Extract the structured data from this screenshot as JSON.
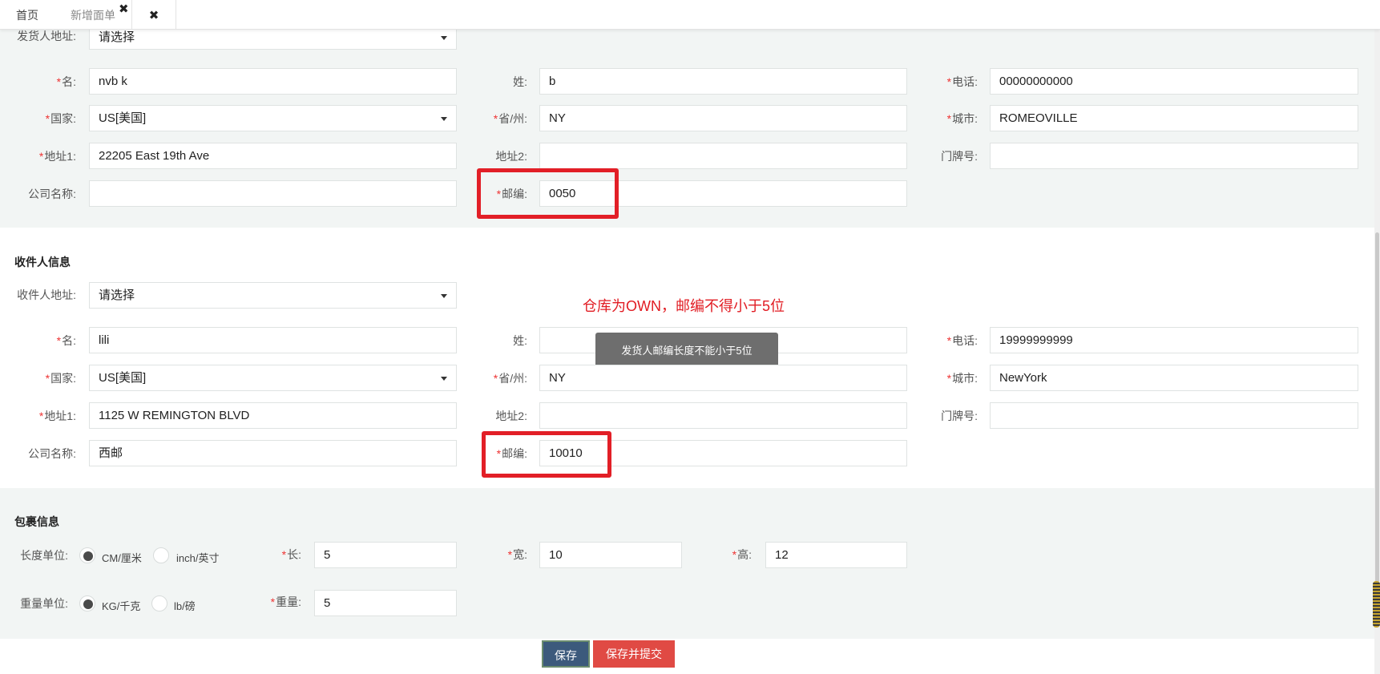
{
  "tabs": [
    {
      "label": "首页"
    },
    {
      "label": "新增面单"
    }
  ],
  "sender": {
    "address_label": "发货人地址:",
    "address_value": "请选择",
    "first_name_label": "名:",
    "first_name": "nvb k",
    "last_name_label": "姓:",
    "last_name": "b",
    "phone_label": "电话:",
    "phone": "00000000000",
    "country_label": "国家:",
    "country": "US[美国]",
    "state_label": "省/州:",
    "state": "NY",
    "city_label": "城市:",
    "city": "ROMEOVILLE",
    "address1_label": "地址1:",
    "address1": "22205 East 19th Ave",
    "address2_label": "地址2:",
    "address2": "",
    "door_label": "门牌号:",
    "door": "",
    "company_label": "公司名称:",
    "company": "",
    "zip_label": "邮编:",
    "zip": "0050"
  },
  "receiver": {
    "section_title": "收件人信息",
    "address_label": "收件人地址:",
    "address_value": "请选择",
    "first_name_label": "名:",
    "first_name": "lili",
    "last_name_label": "姓:",
    "last_name": "",
    "phone_label": "电话:",
    "phone": "19999999999",
    "country_label": "国家:",
    "country": "US[美国]",
    "state_label": "省/州:",
    "state": "NY",
    "city_label": "城市:",
    "city": "NewYork",
    "address1_label": "地址1:",
    "address1": "1125 W REMINGTON BLVD",
    "address2_label": "地址2:",
    "address2": "",
    "door_label": "门牌号:",
    "door": "",
    "company_label": "公司名称:",
    "company": "西邮",
    "zip_label": "邮编:",
    "zip": "10010"
  },
  "annotation": "仓库为OWN，邮编不得小于5位",
  "toast": "发货人邮编长度不能小于5位",
  "package": {
    "section_title": "包裹信息",
    "length_unit_label": "长度单位:",
    "length_unit_options": [
      "CM/厘米",
      "inch/英寸"
    ],
    "length_unit_selected": "CM/厘米",
    "length_label": "长:",
    "length": "5",
    "width_label": "宽:",
    "width": "10",
    "height_label": "高:",
    "height": "12",
    "weight_unit_label": "重量单位:",
    "weight_unit_options": [
      "KG/千克",
      "lb/磅"
    ],
    "weight_unit_selected": "KG/千克",
    "weight_label": "重量:",
    "weight": "5"
  },
  "buttons": {
    "save": "保存",
    "save_submit": "保存并提交"
  },
  "colors": {
    "required_mark": "#e33333",
    "highlight": "#e21f27",
    "save_button": "#3c5a7c",
    "submit_button": "#e04a44"
  }
}
